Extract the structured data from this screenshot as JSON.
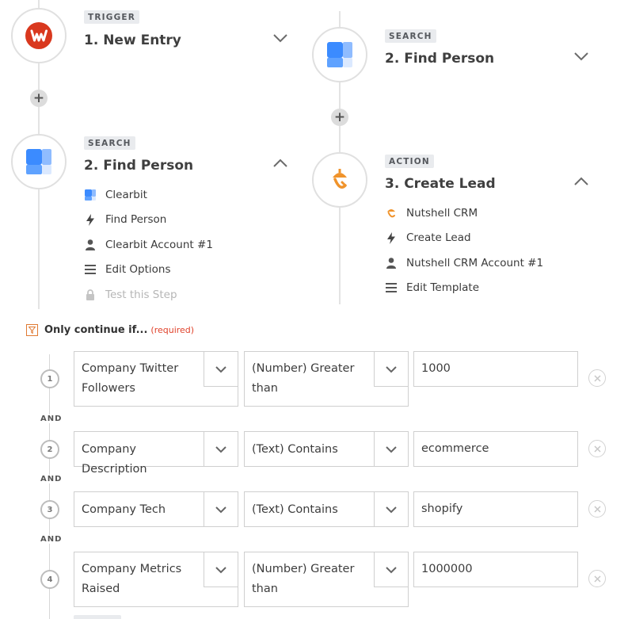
{
  "colors": {
    "accent_orange": "#e07a33",
    "required_red": "#e0432c",
    "clearbit_blue": "#3b8bff",
    "wufoo_red": "#d9381e",
    "nutshell_orange": "#f0932b"
  },
  "steps": [
    {
      "badge": "TRIGGER",
      "title": "1. New Entry",
      "icon": "wufoo-logo-icon",
      "expanded": false
    },
    {
      "badge": "SEARCH",
      "title": "2. Find Person",
      "icon": "clearbit-logo-icon",
      "expanded": false
    },
    {
      "badge": "SEARCH",
      "title": "2. Find Person",
      "icon": "clearbit-logo-icon",
      "expanded": true,
      "items": [
        {
          "icon": "clearbit-app-icon",
          "label": "Clearbit"
        },
        {
          "icon": "bolt-icon",
          "label": "Find Person"
        },
        {
          "icon": "user-icon",
          "label": "Clearbit Account #1"
        },
        {
          "icon": "list-icon",
          "label": "Edit Options"
        },
        {
          "icon": "lock-icon",
          "label": "Test this Step"
        }
      ]
    },
    {
      "badge": "ACTION",
      "title": "3. Create Lead",
      "icon": "nutshell-logo-icon",
      "expanded": true,
      "items": [
        {
          "icon": "nutshell-app-icon",
          "label": "Nutshell CRM"
        },
        {
          "icon": "bolt-icon",
          "label": "Create Lead"
        },
        {
          "icon": "user-icon",
          "label": "Nutshell CRM Account #1"
        },
        {
          "icon": "list-icon",
          "label": "Edit Template"
        }
      ]
    }
  ],
  "filter": {
    "label": "Only continue if...",
    "required": "(required)",
    "connector": "AND",
    "conditions": [
      {
        "num": "1",
        "field": "Company Twitter Followers",
        "operator": "(Number) Greater than",
        "value": "1000"
      },
      {
        "num": "2",
        "field": "Company Description",
        "operator": "(Text) Contains",
        "value": "ecommerce"
      },
      {
        "num": "3",
        "field": "Company Tech",
        "operator": "(Text) Contains",
        "value": "shopify"
      },
      {
        "num": "4",
        "field": "Company Metrics Raised",
        "operator": "(Number) Greater than",
        "value": "1000000"
      }
    ]
  }
}
